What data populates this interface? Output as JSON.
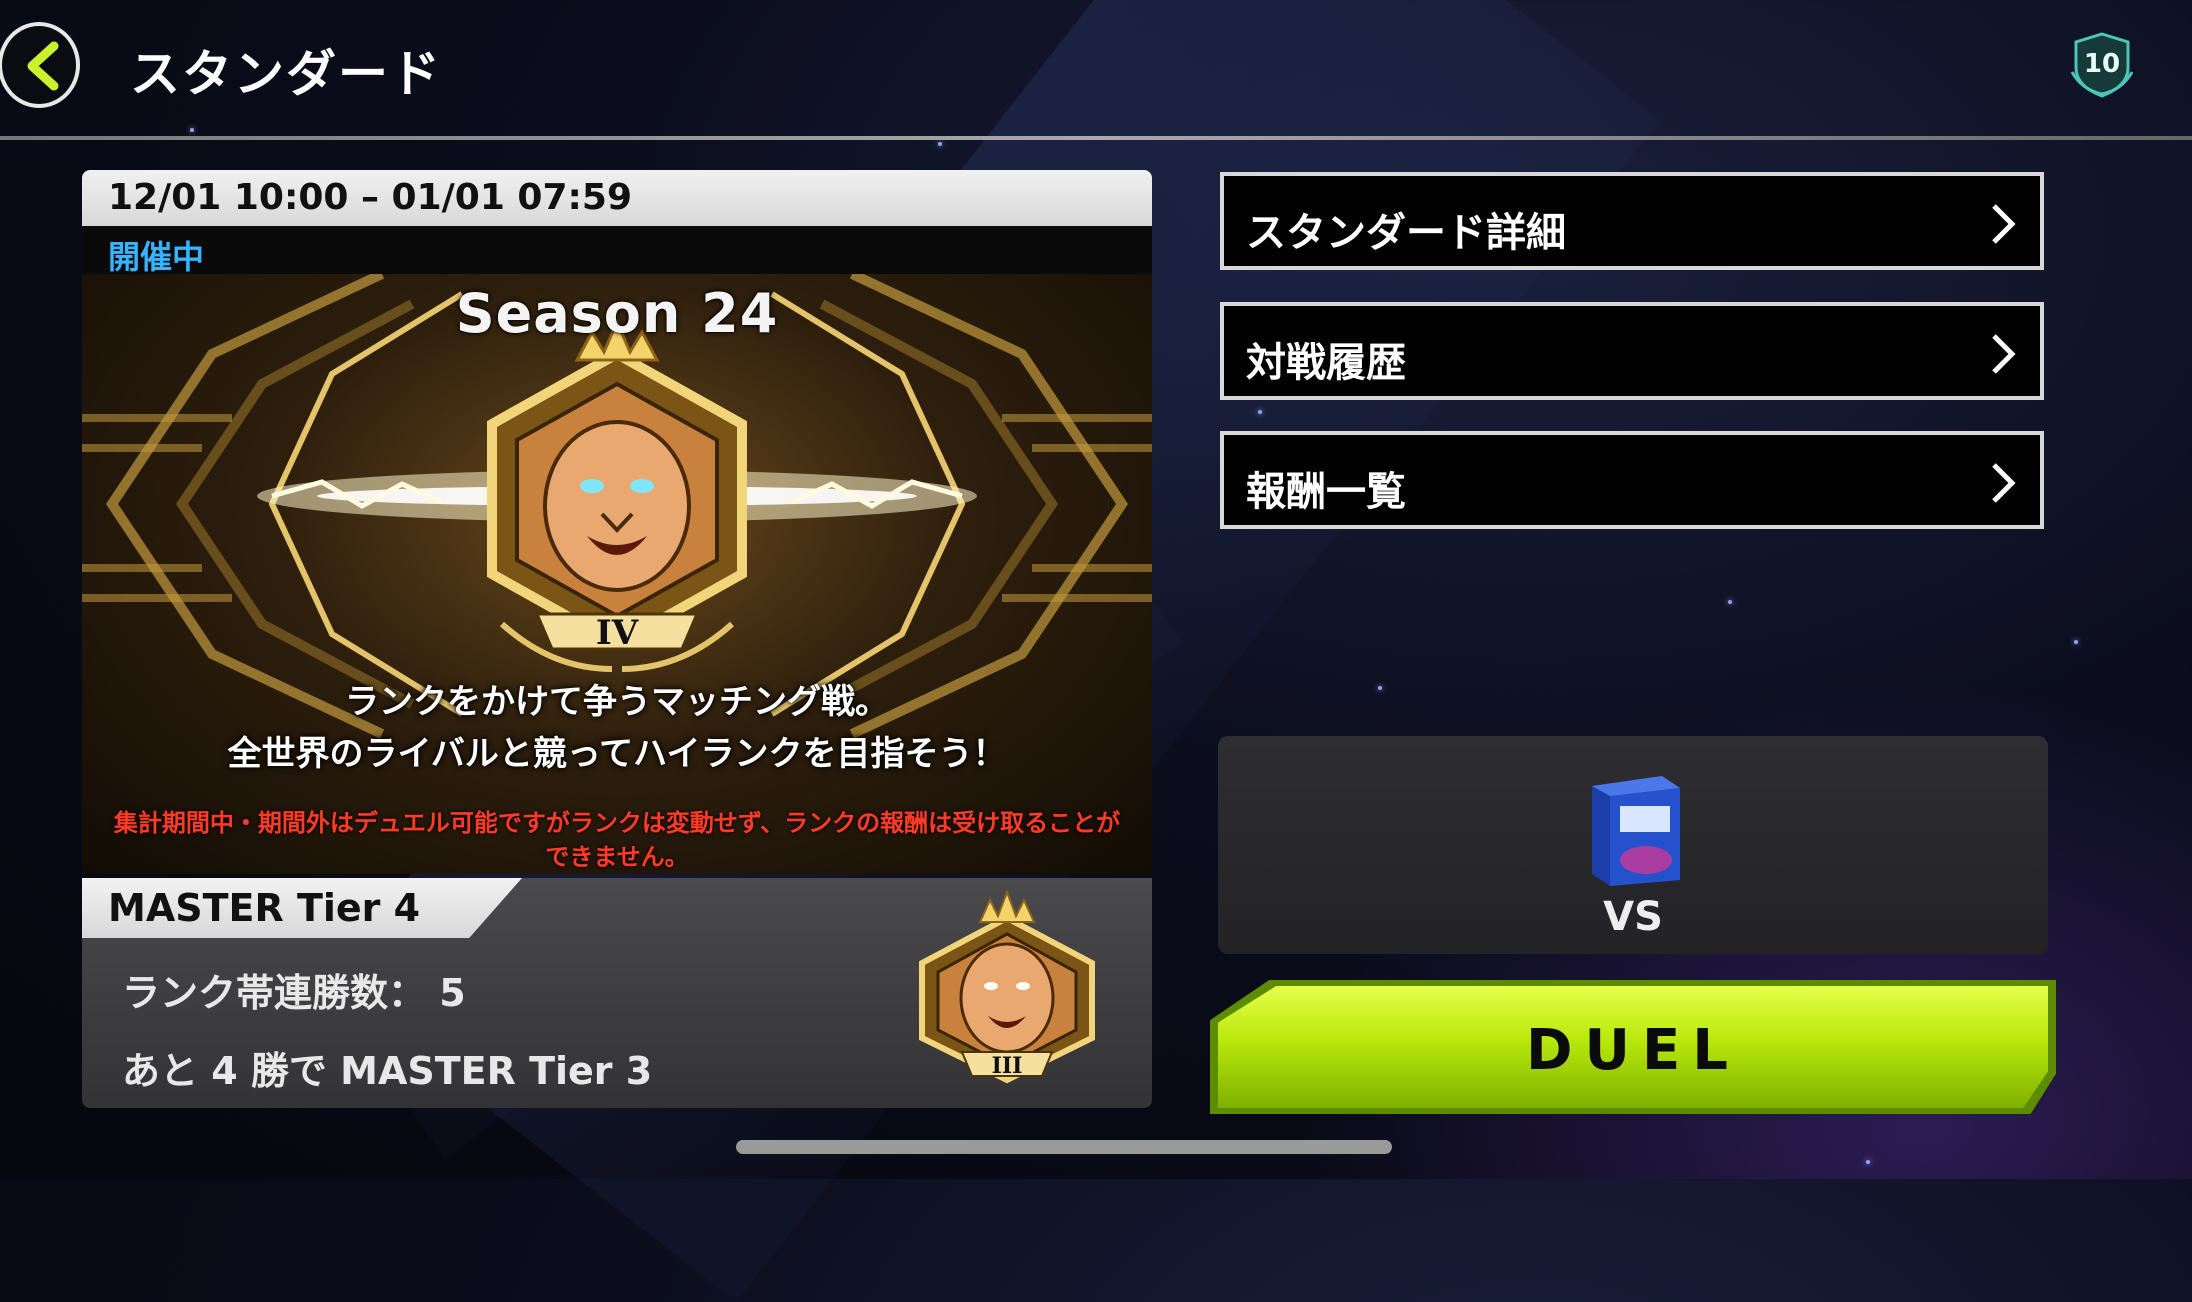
{
  "header": {
    "title": "スタンダード",
    "back_icon": "chevron-left-icon",
    "rank_badge": "10"
  },
  "season": {
    "period": "12/01 10:00 – 01/01 07:59",
    "status": "開催中",
    "title": "Season 24",
    "emblem_tier": "IV",
    "description_line1": "ランクをかけて争うマッチング戦。",
    "description_line2": "全世界のライバルと競ってハイランクを目指そう！",
    "warning": "集計期間中・期間外はデュエル可能ですがランクは変動せず、ランクの報酬は受け取ることができません。"
  },
  "rank": {
    "tier": "MASTER Tier 4",
    "streak": "ランク帯連勝数： 5",
    "next": "あと 4 勝で  MASTER Tier 3",
    "small_emblem_tier": "III"
  },
  "menu": [
    {
      "label": "スタンダード詳細"
    },
    {
      "label": "対戦履歴"
    },
    {
      "label": "報酬一覧"
    }
  ],
  "deck": {
    "vs_label": "VS"
  },
  "duel_button": {
    "label": "DUEL"
  },
  "colors": {
    "status_blue": "#36b4ff",
    "warning_red": "#ff3b28",
    "duel_green": "#c6f21a",
    "gold": "#d9b24a"
  }
}
